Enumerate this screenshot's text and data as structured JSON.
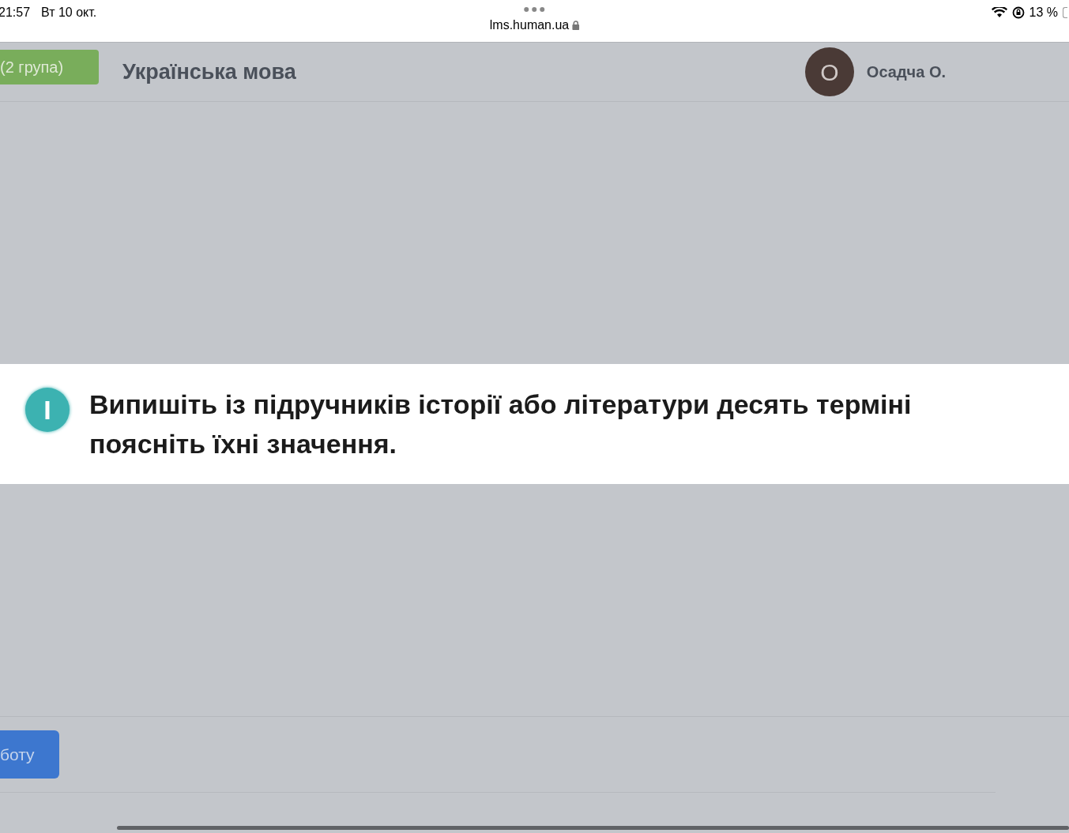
{
  "status_bar": {
    "time": "21:57",
    "date": "Вт 10 окт.",
    "url": "lms.human.ua",
    "battery": "13 %"
  },
  "header": {
    "group_badge": "(2 група)",
    "course_title": "Українська мова",
    "avatar_letter": "О",
    "user_name": "Осадча О."
  },
  "task_banner": {
    "marker": "І",
    "lines": [
      "Випишіть із підручників історії або літератури десять терміні",
      "поясніть їхні значення."
    ]
  },
  "footer": {
    "button": "боту"
  }
}
